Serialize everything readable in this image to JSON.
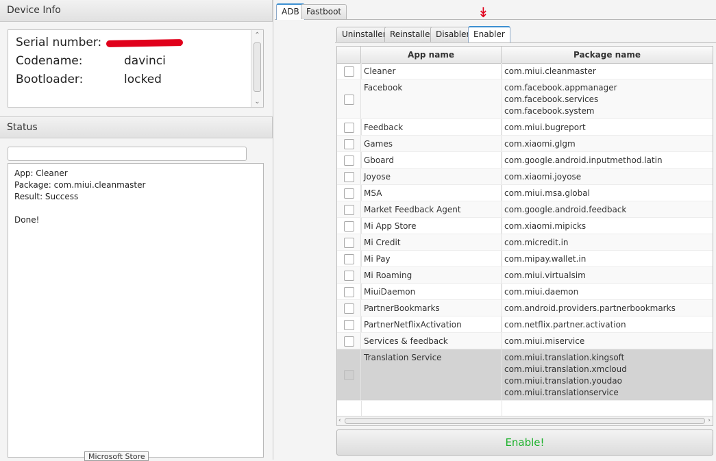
{
  "device_info": {
    "title": "Device Info",
    "rows": [
      {
        "label": "Serial number:",
        "value": ""
      },
      {
        "label": "Codename:",
        "value": "davinci"
      },
      {
        "label": "Bootloader:",
        "value": "locked"
      }
    ]
  },
  "status": {
    "title": "Status",
    "progress_value": "",
    "log_lines": [
      "App: Cleaner",
      "Package: com.miui.cleanmaster",
      "Result: Success",
      "",
      "Done!"
    ]
  },
  "tooltip": "Microsoft Store",
  "main_tabs": [
    {
      "label": "ADB",
      "active": true
    },
    {
      "label": "Fastboot",
      "active": false
    }
  ],
  "sub_tabs": [
    {
      "label": "Uninstaller",
      "active": false
    },
    {
      "label": "Reinstaller",
      "active": false
    },
    {
      "label": "Disabler",
      "active": false
    },
    {
      "label": "Enabler",
      "active": true
    }
  ],
  "annotation_arrow": "↡",
  "table": {
    "headers": {
      "app": "App name",
      "package": "Package name"
    },
    "rows": [
      {
        "app": "Cleaner",
        "packages": [
          "com.miui.cleanmaster"
        ]
      },
      {
        "app": "Facebook",
        "packages": [
          "com.facebook.appmanager",
          "com.facebook.services",
          "com.facebook.system"
        ]
      },
      {
        "app": "Feedback",
        "packages": [
          "com.miui.bugreport"
        ]
      },
      {
        "app": "Games",
        "packages": [
          "com.xiaomi.glgm"
        ]
      },
      {
        "app": "Gboard",
        "packages": [
          "com.google.android.inputmethod.latin"
        ]
      },
      {
        "app": "Joyose",
        "packages": [
          "com.xiaomi.joyose"
        ]
      },
      {
        "app": "MSA",
        "packages": [
          "com.miui.msa.global"
        ]
      },
      {
        "app": "Market Feedback Agent",
        "packages": [
          "com.google.android.feedback"
        ]
      },
      {
        "app": "Mi App Store",
        "packages": [
          "com.xiaomi.mipicks"
        ]
      },
      {
        "app": "Mi Credit",
        "packages": [
          "com.micredit.in"
        ]
      },
      {
        "app": "Mi Pay",
        "packages": [
          "com.mipay.wallet.in"
        ]
      },
      {
        "app": "Mi Roaming",
        "packages": [
          "com.miui.virtualsim"
        ]
      },
      {
        "app": "MiuiDaemon",
        "packages": [
          "com.miui.daemon"
        ]
      },
      {
        "app": "PartnerBookmarks",
        "packages": [
          "com.android.providers.partnerbookmarks"
        ]
      },
      {
        "app": "PartnerNetflixActivation",
        "packages": [
          "com.netflix.partner.activation"
        ]
      },
      {
        "app": "Services & feedback",
        "packages": [
          "com.miui.miservice"
        ]
      },
      {
        "app": "Translation Service",
        "packages": [
          "com.miui.translation.kingsoft",
          "com.miui.translation.xmcloud",
          "com.miui.translation.youdao",
          "com.miui.translationservice"
        ],
        "selected": true
      }
    ]
  },
  "enable_button": {
    "label": "Enable!",
    "color": "#1bb12a"
  }
}
